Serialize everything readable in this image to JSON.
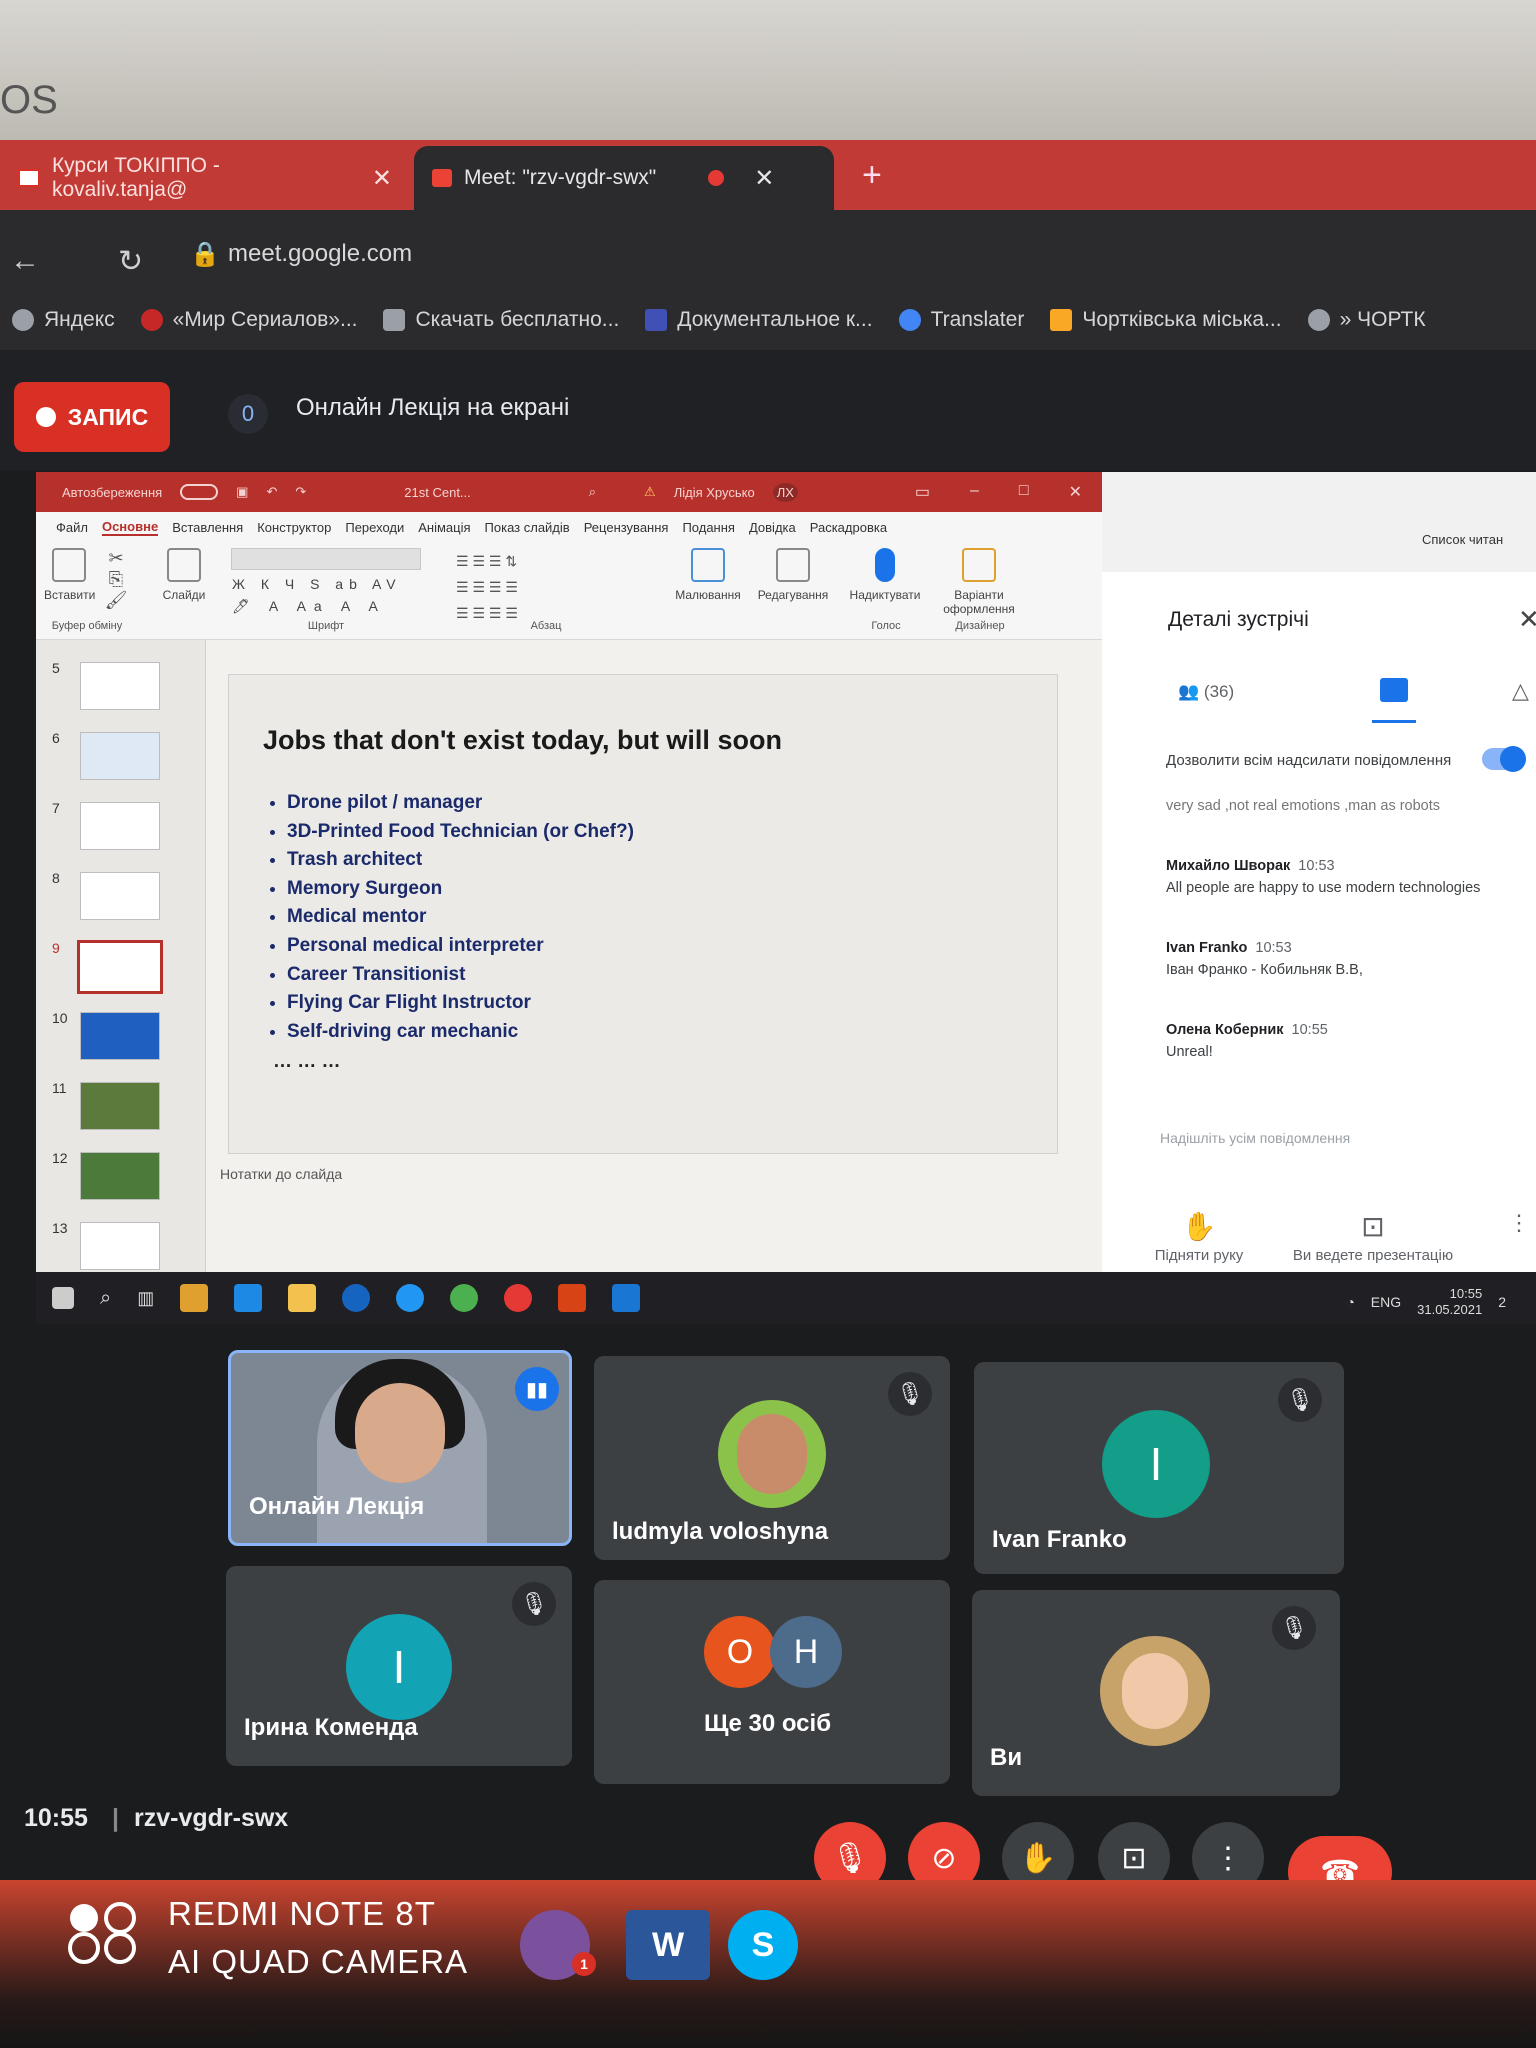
{
  "bezel_label": "OS",
  "browser": {
    "tabs": [
      {
        "label": "Курси ТОКІППО - kovaliv.tanja@",
        "active": false
      },
      {
        "label": "Meet: \"rzv-vgdr-swx\"",
        "active": true
      }
    ],
    "new_tab": "+",
    "url": "meet.google.com",
    "bookmarks": [
      "Яндекс",
      "«Мир Сериалов»...",
      "Скачать бесплатно...",
      "Документальное к...",
      "Translater",
      "Чортківська міська...",
      "» ЧОРТК"
    ]
  },
  "meet": {
    "record_label": "ЗАПИС",
    "counter": "0",
    "title": "Онлайн Лекція на екрані",
    "time": "10:55",
    "code": "rzv-vgdr-swx"
  },
  "powerpoint": {
    "titlebar": {
      "autosave": "Автозбереження",
      "filename": "21st Cent...",
      "user": "Лідія Хрусько",
      "initials": "ЛХ"
    },
    "ribbon_tabs": [
      "Файл",
      "Основне",
      "Вставлення",
      "Конструктор",
      "Переходи",
      "Анімація",
      "Показ слайдів",
      "Рецензування",
      "Подання",
      "Довідка",
      "Раскадровка"
    ],
    "ribbon_groups": {
      "paste": "Вставити",
      "slides": "Слайди",
      "clipboard": "Буфер обміну",
      "font": "Шрифт",
      "paragraph": "Абзац",
      "drawing": "Малювання",
      "editing": "Редагування",
      "dictate": "Надиктувати",
      "voice": "Голос",
      "designer": "Варіанти оформлення",
      "designer_group": "Дизайнер"
    },
    "slide_numbers": [
      "5",
      "6",
      "7",
      "8",
      "9",
      "10",
      "11",
      "12",
      "13"
    ],
    "selected_slide": "9",
    "slide": {
      "title": "Jobs that don't exist today, but will soon",
      "bullets": [
        "Drone pilot / manager",
        "3D-Printed Food Technician (or Chef?)",
        "Trash architect",
        "Memory Surgeon",
        "Medical mentor",
        "Personal medical interpreter",
        "Career Transitionist",
        "Flying Car Flight Instructor",
        "Self-driving car mechanic"
      ],
      "ellipsis": "… … …"
    },
    "notes": "Нотатки до слайда"
  },
  "chat_panel": {
    "reading_list": "Список читан",
    "title": "Деталі зустрічі",
    "people_count": "(36)",
    "allow_label": "Дозволити всім надсилати повідомлення",
    "partial_msg": "very sad ,not real emotions ,man as robots",
    "messages": [
      {
        "author": "Михайло Шворак",
        "time": "10:53",
        "text": "All people are happy to use modern technologies"
      },
      {
        "author": "Ivan Franko",
        "time": "10:53",
        "text": "Іван Франко - Кобильняк В.В,"
      },
      {
        "author": "Олена Коберник",
        "time": "10:55",
        "text": "Unreal!"
      }
    ],
    "send_placeholder": "Надішліть усім повідомлення",
    "raise_hand": "Підняти руку",
    "presenting": "Ви ведете презентацію"
  },
  "windows_taskbar": {
    "lang": "ENG",
    "time": "10:55",
    "date": "31.05.2021",
    "badge": "2"
  },
  "participants": [
    {
      "name": "Онлайн Лекція"
    },
    {
      "name": "ludmyla voloshyna"
    },
    {
      "name": "Ivan Franko",
      "initial": "I"
    },
    {
      "name": "Ірина Коменда",
      "initial": "I"
    },
    {
      "name": "Ще 30 осіб",
      "initials": [
        "О",
        "Н"
      ]
    },
    {
      "name": "Ви"
    }
  ],
  "physical_taskbar": {
    "viber_badge": "1",
    "word": "W",
    "skype": "S"
  },
  "watermark": {
    "line1": "REDMI NOTE 8T",
    "line2": "AI QUAD CAMERA"
  },
  "colors": {
    "meet_red": "#ea4335",
    "chrome_red": "#c23a36",
    "ppt_red": "#b7312c",
    "meet_bg": "#202124",
    "tile_bg": "#3c4043"
  }
}
